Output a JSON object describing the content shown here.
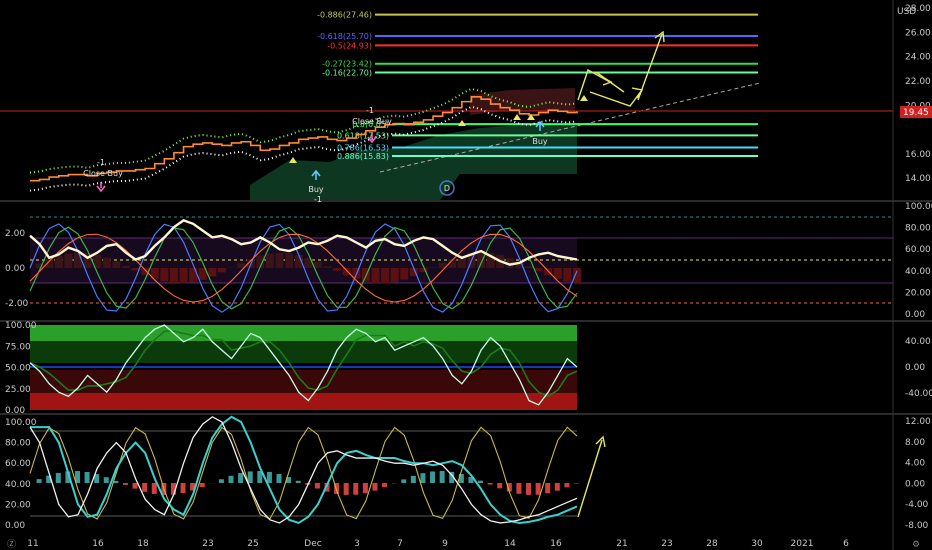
{
  "chart_data": {
    "type": "line",
    "x_ticks": [
      "11",
      "16",
      "18",
      "23",
      "25",
      "Dec",
      "3",
      "7",
      "9",
      "14",
      "16",
      "21",
      "23",
      "28",
      "30",
      "2021",
      "6"
    ],
    "currency": "USD",
    "last_price": "19.45",
    "colors": {
      "up": "#26a69a",
      "down": "#ef5350",
      "accent": "#ff8c33",
      "yellow": "#c8c85a",
      "green": "#00ff66",
      "lime": "#9cff6a"
    },
    "panels": [
      {
        "id": "price",
        "ylim": [
          13,
          28
        ],
        "y_ticks": [
          "28.00",
          "26.00",
          "24.00",
          "22.00",
          "20.00",
          "16.00",
          "14.00"
        ],
        "fib_levels": [
          {
            "label": "-0.886(27.46)",
            "value": 27.46,
            "color": "#c8c850"
          },
          {
            "label": "-0.618(25.70)",
            "value": 25.7,
            "color": "#5a64ff"
          },
          {
            "label": "-0.5(24.93)",
            "value": 24.93,
            "color": "#ff2d2d"
          },
          {
            "label": "-0.27(23.42)",
            "value": 23.42,
            "color": "#33dd44"
          },
          {
            "label": "-0.16(22.70)",
            "value": 22.7,
            "color": "#66ff99"
          },
          {
            "label": "0.5(0.05)",
            "value": 18.45,
            "color": "#33ff77"
          },
          {
            "label": "0.618(17.53)",
            "value": 17.53,
            "color": "#66ff99"
          },
          {
            "label": "0.786(16.53)",
            "value": 16.53,
            "color": "#40e0ff"
          },
          {
            "label": "0.886(15.83)",
            "value": 15.83,
            "color": "#66ffcc"
          }
        ],
        "signals": [
          {
            "text": "-1",
            "sub": "Close Buy",
            "color": "#ff66cc"
          },
          {
            "text": "-1",
            "sub": "Close Buy",
            "color": "#ff66cc"
          },
          {
            "text": "Buy",
            "color": "#66ccff"
          },
          {
            "text": "Buy",
            "color": "#66ccff"
          },
          {
            "text": "-1",
            "color": "#e0e0e0"
          }
        ],
        "marker": "D",
        "price_series": [
          13.8,
          13.9,
          14.1,
          14.2,
          14.3,
          14.3,
          14.2,
          14.4,
          14.5,
          14.6,
          14.6,
          14.7,
          14.8,
          15.2,
          15.6,
          16.1,
          16.6,
          16.8,
          16.9,
          16.8,
          16.7,
          16.9,
          17.0,
          16.7,
          16.3,
          16.4,
          16.7,
          16.9,
          17.2,
          17.3,
          17.4,
          17.2,
          17.1,
          17.3,
          17.6,
          17.9,
          18.2,
          18.4,
          18.5,
          18.4,
          18.6,
          18.8,
          19.1,
          19.4,
          19.8,
          20.3,
          20.7,
          20.5,
          20.1,
          19.8,
          19.6,
          19.3,
          19.2,
          19.4,
          19.6,
          19.5,
          19.4,
          19.5
        ]
      },
      {
        "id": "osc1",
        "ylim_left": [
          -3,
          4
        ],
        "y_ticks_left": [
          "2.00",
          "0.00",
          "-2.00"
        ],
        "y_ticks_right": [
          "100.00",
          "80.00",
          "60.00",
          "40.00",
          "20.00",
          "0.00"
        ],
        "main_series": [
          1.9,
          1.4,
          0.6,
          0.8,
          1.2,
          1.0,
          0.6,
          0.9,
          1.3,
          1.4,
          0.9,
          0.5,
          0.7,
          1.3,
          1.8,
          2.4,
          2.8,
          2.6,
          2.2,
          1.8,
          1.9,
          1.7,
          1.4,
          1.5,
          1.8,
          1.5,
          1.1,
          1.0,
          1.2,
          1.5,
          1.4,
          1.6,
          1.9,
          1.8,
          1.5,
          1.2,
          1.6,
          1.7,
          1.4,
          1.3,
          1.6,
          1.8,
          1.7,
          1.3,
          0.9,
          0.6,
          0.8,
          1.0,
          0.7,
          0.4,
          0.2,
          0.3,
          0.6,
          0.8,
          0.9,
          0.7,
          0.6,
          0.5
        ]
      },
      {
        "id": "osc2",
        "y_ticks_left": [
          "100.00",
          "75.00",
          "50.00",
          "25.00",
          "0.00"
        ],
        "y_ticks_right": [
          "40.00",
          "0.00",
          "-40.00"
        ],
        "main_series": [
          55,
          45,
          30,
          20,
          15,
          25,
          40,
          30,
          20,
          35,
          55,
          70,
          85,
          95,
          100,
          90,
          80,
          85,
          95,
          80,
          70,
          60,
          75,
          90,
          85,
          70,
          55,
          40,
          20,
          10,
          25,
          45,
          70,
          85,
          95,
          90,
          80,
          85,
          70,
          75,
          80,
          85,
          75,
          60,
          40,
          30,
          45,
          70,
          85,
          75,
          55,
          35,
          10,
          5,
          20,
          40,
          60,
          50
        ]
      },
      {
        "id": "osc3",
        "y_ticks_left": [
          "100.00",
          "80.00",
          "60.00",
          "40.00",
          "20.00",
          "0.00"
        ],
        "y_ticks_right": [
          "12.00",
          "8.00",
          "4.00",
          "0.00",
          "-4.00",
          "-8.00"
        ],
        "main_series": [
          95,
          80,
          50,
          20,
          8,
          10,
          30,
          55,
          70,
          80,
          70,
          45,
          25,
          15,
          10,
          30,
          60,
          85,
          98,
          105,
          100,
          80,
          55,
          35,
          15,
          5,
          2,
          8,
          20,
          40,
          60,
          70,
          72,
          68,
          65,
          65,
          65,
          62,
          60,
          60,
          58,
          60,
          62,
          58,
          48,
          35,
          20,
          10,
          4,
          2,
          3,
          5,
          8,
          10,
          14,
          18,
          22,
          26
        ]
      }
    ]
  }
}
